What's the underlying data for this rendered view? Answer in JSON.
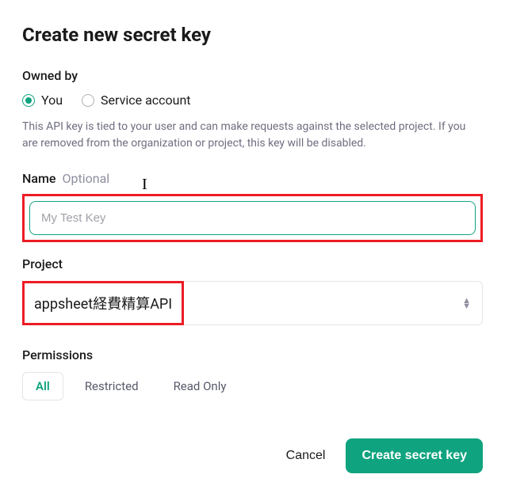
{
  "title": "Create new secret key",
  "owned_by": {
    "label": "Owned by",
    "options": [
      {
        "label": "You",
        "selected": true
      },
      {
        "label": "Service account",
        "selected": false
      }
    ],
    "help": "This API key is tied to your user and can make requests against the selected project. If you are removed from the organization or project, this key will be disabled."
  },
  "name": {
    "label": "Name",
    "optional_text": "Optional",
    "placeholder": "My Test Key",
    "value": ""
  },
  "project": {
    "label": "Project",
    "selected": "appsheet経費精算API"
  },
  "permissions": {
    "label": "Permissions",
    "options": [
      "All",
      "Restricted",
      "Read Only"
    ],
    "selected": "All"
  },
  "footer": {
    "cancel": "Cancel",
    "create": "Create secret key"
  },
  "colors": {
    "accent": "#10a37f",
    "highlight": "#ed1c24"
  }
}
